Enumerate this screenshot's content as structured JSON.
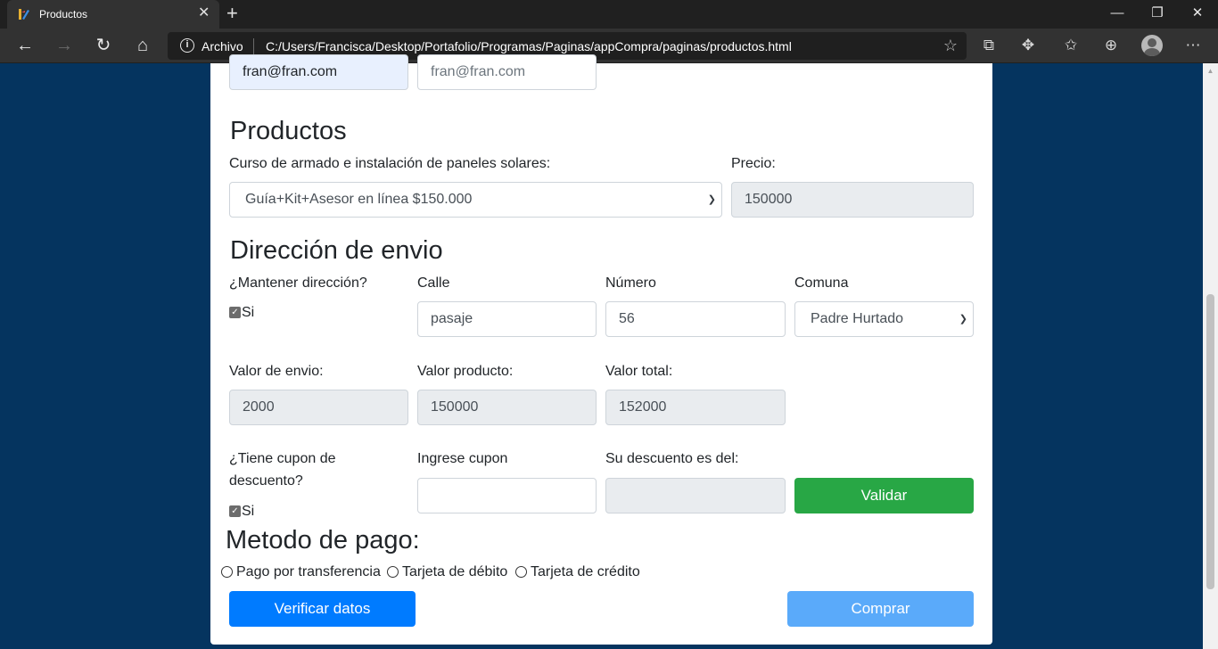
{
  "browser": {
    "tab_title": "Productos",
    "address_label": "Archivo",
    "url": "C:/Users/Francisca/Desktop/Portafolio/Programas/Paginas/appCompra/paginas/productos.html"
  },
  "contact": {
    "email_value": "fran@fran.com",
    "email_confirm_placeholder": "fran@fran.com"
  },
  "productos": {
    "heading": "Productos",
    "course_label": "Curso de armado e instalación de paneles solares:",
    "course_selected": "Guía+Kit+Asesor en línea $150.000",
    "price_label": "Precio:",
    "price_value": "150000"
  },
  "envio": {
    "heading": "Dirección de envio",
    "keep_label": "¿Mantener dirección?",
    "keep_checkbox_label": "Si",
    "street_label": "Calle",
    "street_value": "pasaje",
    "number_label": "Número",
    "number_value": "56",
    "comuna_label": "Comuna",
    "comuna_selected": "Padre Hurtado",
    "shipping_label": "Valor de envio:",
    "shipping_value": "2000",
    "product_value_label": "Valor producto:",
    "product_value": "150000",
    "total_label": "Valor total:",
    "total_value": "152000",
    "coupon_question_line1": "¿Tiene cupon de",
    "coupon_question_line2": "descuento?",
    "coupon_checkbox_label": "Si",
    "coupon_input_label": "Ingrese cupon",
    "coupon_value": "",
    "discount_label": "Su descuento es del:",
    "discount_value": "",
    "validate_button": "Validar"
  },
  "pago": {
    "heading": "Metodo de pago:",
    "options": [
      "Pago por transferencia",
      "Tarjeta de débito",
      "Tarjeta de crédito"
    ],
    "verify_button": "Verificar datos",
    "buy_button": "Comprar"
  },
  "colors": {
    "page_background": "#05345f",
    "primary": "#007bff",
    "primary_disabled": "#5aaafa",
    "success": "#28a745",
    "readonly_field": "#e9ecef"
  }
}
